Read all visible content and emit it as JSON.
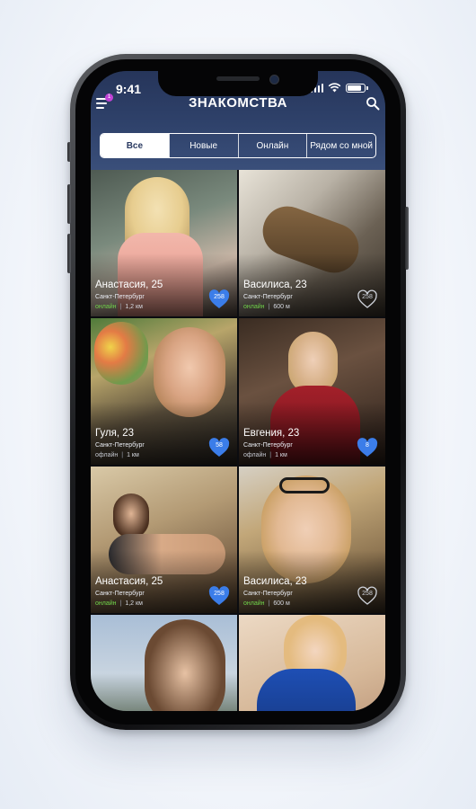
{
  "status_bar": {
    "time": "9:41"
  },
  "header": {
    "title": "ЗНАКОМСТВА",
    "menu_badge": "1",
    "tabs": [
      {
        "label": "Все",
        "active": true
      },
      {
        "label": "Новые",
        "active": false
      },
      {
        "label": "Онлайн",
        "active": false
      },
      {
        "label": "Рядом со мной",
        "active": false
      }
    ]
  },
  "colors": {
    "accent": "#3b7de9",
    "header": "#2f426b",
    "online": "#6fd24a"
  },
  "profiles": [
    {
      "name": "Анастасия, 25",
      "city": "Санкт-Петербург",
      "status": "онлайн",
      "online": true,
      "distance": "1,2 км",
      "likes": "258",
      "liked": true
    },
    {
      "name": "Василиса, 23",
      "city": "Санкт-Петербург",
      "status": "онлайн",
      "online": true,
      "distance": "600 м",
      "likes": "258",
      "liked": false
    },
    {
      "name": "Гуля, 23",
      "city": "Санкт-Петербург",
      "status": "офлайн",
      "online": false,
      "distance": "1 км",
      "likes": "58",
      "liked": true
    },
    {
      "name": "Евгения, 23",
      "city": "Санкт-Петербург",
      "status": "офлайн",
      "online": false,
      "distance": "1 км",
      "likes": "8",
      "liked": true
    },
    {
      "name": "Анастасия, 25",
      "city": "Санкт-Петербург",
      "status": "онлайн",
      "online": true,
      "distance": "1,2 км",
      "likes": "258",
      "liked": true
    },
    {
      "name": "Василиса, 23",
      "city": "Санкт-Петербург",
      "status": "онлайн",
      "online": true,
      "distance": "600 м",
      "likes": "258",
      "liked": false
    }
  ]
}
